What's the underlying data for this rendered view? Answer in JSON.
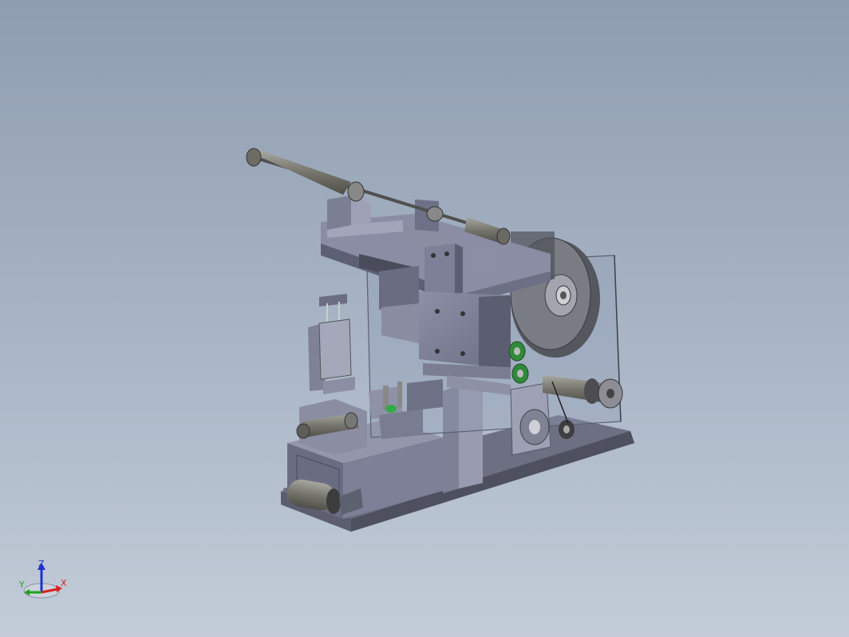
{
  "viewport": {
    "model_name": "machine-assembly"
  },
  "triad": {
    "x_label": "X",
    "y_label": "Y",
    "z_label": "Z",
    "colors": {
      "x": "#d62020",
      "y": "#20a020",
      "z": "#2030d0"
    }
  }
}
